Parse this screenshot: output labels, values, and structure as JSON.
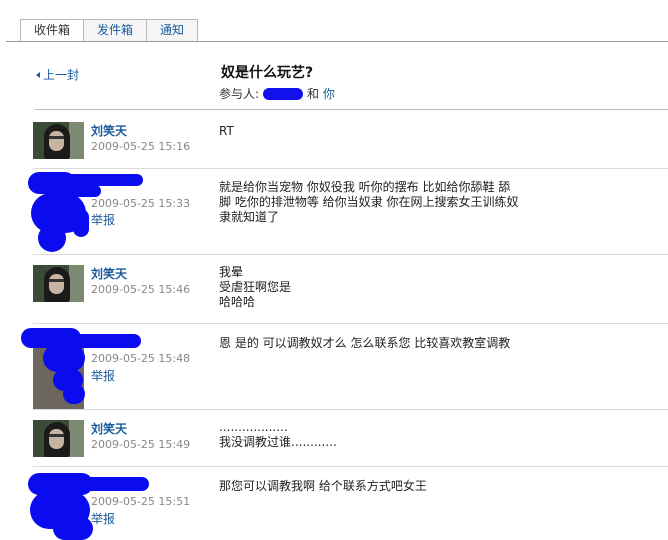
{
  "tabs": [
    {
      "label": "收件箱",
      "active": true
    },
    {
      "label": "发件箱",
      "active": false
    },
    {
      "label": "通知",
      "active": false
    }
  ],
  "nav": {
    "prev_label": "上一封"
  },
  "thread": {
    "subject": "奴是什么玩艺?",
    "participants_label": "参与人:",
    "and_label": "和",
    "you_label": "你"
  },
  "messages": [
    {
      "author": "刘笑天",
      "time": "2009-05-25 15:16",
      "lines": [
        "RT"
      ]
    },
    {
      "author": "",
      "time": "2009-05-25 15:33",
      "report": "举报",
      "lines": [
        "就是给你当宠物 你奴役我 听你的摆布 比如给你舔鞋 舔",
        "脚 吃你的排泄物等 给你当奴隶 你在网上搜索女王训练奴",
        "隶就知道了"
      ]
    },
    {
      "author": "刘笑天",
      "time": "2009-05-25 15:46",
      "lines": [
        "我晕",
        "受虐狂啊您是",
        "哈哈哈"
      ]
    },
    {
      "author": "",
      "time": "2009-05-25 15:48",
      "report": "举报",
      "lines": [
        "恩 是的 可以调教奴才么 怎么联系您 比较喜欢教室调教"
      ]
    },
    {
      "author": "刘笑天",
      "time": "2009-05-25 15:49",
      "lines": [
        "..................",
        "我没调教过谁............"
      ]
    },
    {
      "author": "",
      "time": "2009-05-25 15:51",
      "report": "举报",
      "lines": [
        "那您可以调教我啊 给个联系方式吧女王"
      ]
    }
  ],
  "colors": {
    "link": "#1a5a9c",
    "censor": "#0b0bf0",
    "timestamp": "#888888"
  }
}
